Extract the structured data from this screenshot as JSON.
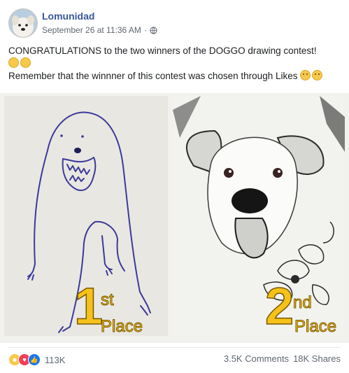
{
  "post": {
    "page_name": "Lomunidad",
    "timestamp": "September 26 at 11:36 AM",
    "separator": "·",
    "line1": "CONGRATULATIONS to the two winners of the DOGGO drawing contest!",
    "line3": "Remember that the winnner of this contest was chosen through Likes"
  },
  "photo": {
    "left": {
      "num": "1",
      "sup": "st",
      "word": "Place"
    },
    "right": {
      "num": "2",
      "sup": "nd",
      "word": "Place"
    }
  },
  "footer": {
    "reaction_count": "113K",
    "comments": "3.5K Comments",
    "shares": "18K Shares",
    "reaction_icons": [
      "haha-icon",
      "love-icon",
      "like-icon"
    ]
  },
  "colors": {
    "page_name": "#385898",
    "meta": "#606770",
    "place_yellow": "#f6c21a",
    "like_blue": "#1877f2",
    "love_red": "#f33e58"
  }
}
